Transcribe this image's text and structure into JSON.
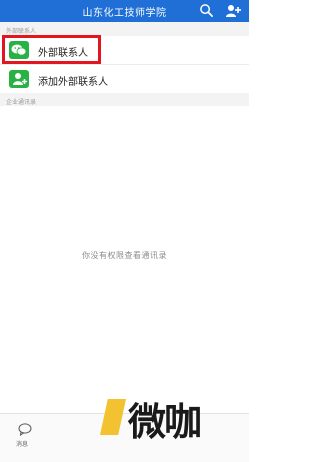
{
  "header": {
    "title": "山东化工技师学院",
    "search_icon": "search-icon",
    "add_icon": "add-contact-icon"
  },
  "sections": {
    "external_label": "外部联系人",
    "enterprise_label": "企业通讯录"
  },
  "rows": [
    {
      "label": "外部联系人",
      "icon": "wechat-icon",
      "highlighted": true
    },
    {
      "label": "添加外部联系人",
      "icon": "add-person-icon",
      "highlighted": false
    }
  ],
  "empty_message": "你没有权限查看通讯录",
  "bottom_bar": {
    "messages_label": "消息",
    "messages_icon": "chat-bubble-icon"
  },
  "watermark": {
    "text": "微咖"
  },
  "colors": {
    "header": "#1f6fd6",
    "icon_green": "#28b245",
    "highlight": "#e3161f",
    "watermark_accent": "#f2c230"
  }
}
